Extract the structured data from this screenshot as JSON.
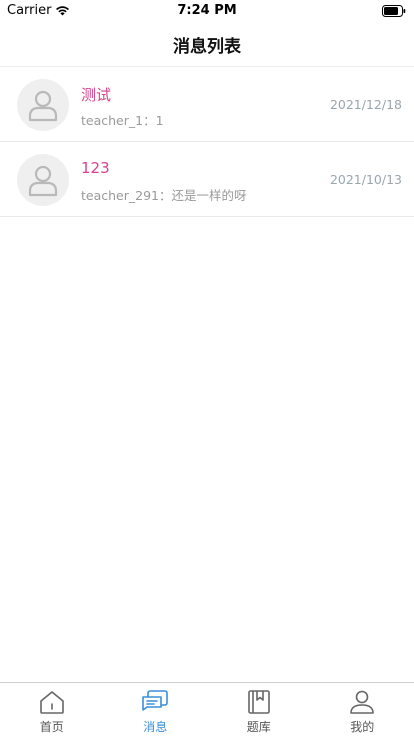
{
  "status_bar": {
    "carrier": "Carrier",
    "time": "7:24 PM"
  },
  "header": {
    "title": "消息列表"
  },
  "messages": [
    {
      "title": "测试",
      "preview": "teacher_1：1",
      "date": "2021/12/18"
    },
    {
      "title": "123",
      "preview": "teacher_291：还是一样的呀",
      "date": "2021/10/13"
    }
  ],
  "tabs": [
    {
      "label": "首页",
      "icon": "home-icon"
    },
    {
      "label": "消息",
      "icon": "message-icon",
      "active": true
    },
    {
      "label": "题库",
      "icon": "book-icon"
    },
    {
      "label": "我的",
      "icon": "profile-icon"
    }
  ],
  "colors": {
    "accent": "#3a8fd8",
    "title_pink": "#d9418e",
    "muted": "#9a9a9a"
  }
}
